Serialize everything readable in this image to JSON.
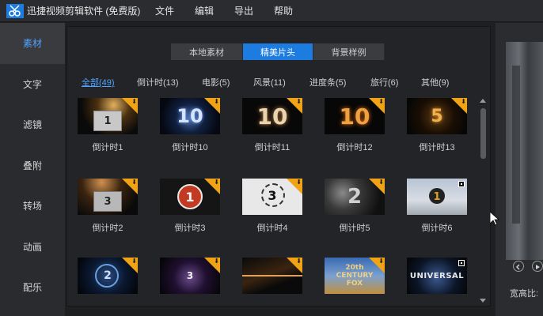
{
  "app": {
    "title": "迅捷视频剪辑软件 (免费版)"
  },
  "menu": [
    "文件",
    "编辑",
    "导出",
    "帮助"
  ],
  "sidebar": {
    "items": [
      {
        "label": "素材",
        "active": true
      },
      {
        "label": "文字"
      },
      {
        "label": "滤镜"
      },
      {
        "label": "叠附"
      },
      {
        "label": "转场"
      },
      {
        "label": "动画"
      },
      {
        "label": "配乐"
      }
    ]
  },
  "tabs": [
    {
      "label": "本地素材"
    },
    {
      "label": "精美片头",
      "active": true
    },
    {
      "label": "背景样例"
    }
  ],
  "filters": [
    {
      "label": "全部(49)",
      "active": true
    },
    {
      "label": "倒计时(13)"
    },
    {
      "label": "电影(5)"
    },
    {
      "label": "风景(11)"
    },
    {
      "label": "进度条(5)"
    },
    {
      "label": "旅行(6)"
    },
    {
      "label": "其他(9)"
    }
  ],
  "thumbnails": [
    {
      "label": "倒计时1",
      "art": "1",
      "badge": "download"
    },
    {
      "label": "倒计时10",
      "art": "10",
      "badge": "download"
    },
    {
      "label": "倒计时11",
      "art": "10",
      "badge": "download"
    },
    {
      "label": "倒计时12",
      "art": "10",
      "badge": "download"
    },
    {
      "label": "倒计时13",
      "art": "5",
      "badge": "download"
    },
    {
      "label": "倒计时2",
      "art": "3",
      "badge": "download"
    },
    {
      "label": "倒计时3",
      "art": "1",
      "badge": "download"
    },
    {
      "label": "倒计时4",
      "art": "3",
      "badge": "download"
    },
    {
      "label": "倒计时5",
      "art": "2",
      "badge": "download"
    },
    {
      "label": "倒计时6",
      "art": "1",
      "badge": "box"
    },
    {
      "label": "",
      "art": "2",
      "badge": "download"
    },
    {
      "label": "",
      "art": "3",
      "badge": "download"
    },
    {
      "label": "",
      "art": "",
      "badge": "download"
    },
    {
      "label": "",
      "art": "20th CENTURY FOX",
      "badge": "download"
    },
    {
      "label": "",
      "art": "UNIVERSAL",
      "badge": "box"
    }
  ],
  "preview": {
    "ratio_label": "宽高比:"
  },
  "colors": {
    "accent": "#1c7ce0",
    "link": "#4fa3ff",
    "badge": "#f0a415"
  }
}
